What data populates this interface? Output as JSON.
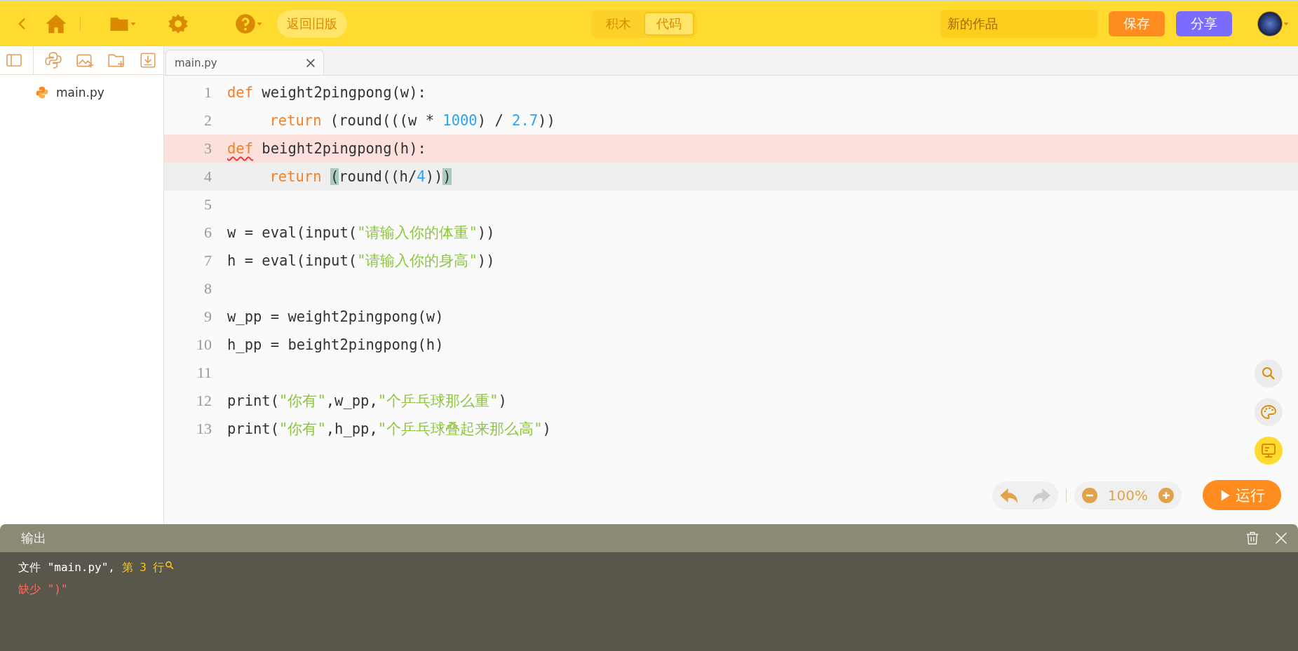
{
  "toolbar": {
    "legacy_button": "返回旧版",
    "mode_tabs": [
      {
        "label": "积木",
        "selected": false
      },
      {
        "label": "代码",
        "selected": true
      }
    ],
    "title_field": {
      "placeholder": "新的作品"
    },
    "save_button": "保存",
    "share_button": "分享"
  },
  "sidebar": {
    "files": [
      {
        "name": "main.py"
      }
    ]
  },
  "editor": {
    "tabs": [
      {
        "label": "main.py",
        "selected": true
      }
    ],
    "lines": [
      {
        "number": "1",
        "error": false,
        "current": false,
        "indented": false,
        "tokens": [
          {
            "kind": "kw",
            "text": "def"
          },
          {
            "kind": "plain",
            "text": " weight2pingpong(w):"
          }
        ]
      },
      {
        "number": "2",
        "error": false,
        "current": false,
        "indented": true,
        "tokens": [
          {
            "kind": "kw",
            "text": "return"
          },
          {
            "kind": "plain",
            "text": " (round(((w * "
          },
          {
            "kind": "num",
            "text": "1000"
          },
          {
            "kind": "plain",
            "text": ") / "
          },
          {
            "kind": "num",
            "text": "2.7"
          },
          {
            "kind": "plain",
            "text": "))"
          }
        ]
      },
      {
        "number": "3",
        "error": true,
        "current": false,
        "indented": false,
        "tokens": [
          {
            "kind": "kw-error",
            "text": "def"
          },
          {
            "kind": "plain",
            "text": " beight2pingpong(h):"
          }
        ]
      },
      {
        "number": "4",
        "error": false,
        "current": true,
        "indented": true,
        "tokens": [
          {
            "kind": "kw",
            "text": "return "
          },
          {
            "kind": "bracket",
            "text": "("
          },
          {
            "kind": "plain",
            "text": "round((h/"
          },
          {
            "kind": "num",
            "text": "4"
          },
          {
            "kind": "plain",
            "text": "))"
          },
          {
            "kind": "bracket",
            "text": ")"
          }
        ]
      },
      {
        "number": "5",
        "error": false,
        "current": false
      },
      {
        "number": "6",
        "error": false,
        "current": false,
        "indented": false,
        "tokens": [
          {
            "kind": "plain",
            "text": "w = eval(input("
          },
          {
            "kind": "str",
            "text": "\"请输入你的体重\""
          },
          {
            "kind": "plain",
            "text": "))"
          }
        ]
      },
      {
        "number": "7",
        "error": false,
        "current": false,
        "indented": false,
        "tokens": [
          {
            "kind": "plain",
            "text": "h = eval(input("
          },
          {
            "kind": "str",
            "text": "\"请输入你的身高\""
          },
          {
            "kind": "plain",
            "text": "))"
          }
        ]
      },
      {
        "number": "8",
        "error": false,
        "current": false
      },
      {
        "number": "9",
        "error": false,
        "current": false,
        "indented": false,
        "tokens": [
          {
            "kind": "plain",
            "text": "w_pp = weight2pingpong(w)"
          }
        ]
      },
      {
        "number": "10",
        "error": false,
        "current": false,
        "indented": false,
        "tokens": [
          {
            "kind": "plain",
            "text": "h_pp = beight2pingpong(h)"
          }
        ]
      },
      {
        "number": "11",
        "error": false,
        "current": false
      },
      {
        "number": "12",
        "error": false,
        "current": false,
        "indented": false,
        "tokens": [
          {
            "kind": "plain",
            "text": "print("
          },
          {
            "kind": "str",
            "text": "\"你有\""
          },
          {
            "kind": "plain",
            "text": ",w_pp,"
          },
          {
            "kind": "str",
            "text": "\"个乒乓球那么重\""
          },
          {
            "kind": "plain",
            "text": ")"
          }
        ]
      },
      {
        "number": "13",
        "error": false,
        "current": false,
        "indented": false,
        "tokens": [
          {
            "kind": "plain",
            "text": "print("
          },
          {
            "kind": "str",
            "text": "\"你有\""
          },
          {
            "kind": "plain",
            "text": ",h_pp,"
          },
          {
            "kind": "str",
            "text": "\"个乒乓球叠起来那么高\""
          },
          {
            "kind": "plain",
            "text": ")"
          }
        ]
      }
    ],
    "side_tools": [
      {
        "kind": "search",
        "selected": false
      },
      {
        "kind": "palette",
        "selected": false
      },
      {
        "kind": "console",
        "selected": true
      }
    ],
    "undo": {
      "disabled": false
    },
    "redo": {
      "disabled": true
    },
    "zoom": "100%",
    "run_button": "运行"
  },
  "output": {
    "title": "输出",
    "lines": [
      {
        "kind": "location",
        "segments": [
          {
            "kind": "plain",
            "text": "文件 \"main.py\", "
          },
          {
            "kind": "link",
            "text": "第 3 行"
          }
        ]
      },
      {
        "kind": "error",
        "segments": [
          {
            "kind": "error",
            "text": "缺少 \")\""
          }
        ]
      }
    ]
  }
}
